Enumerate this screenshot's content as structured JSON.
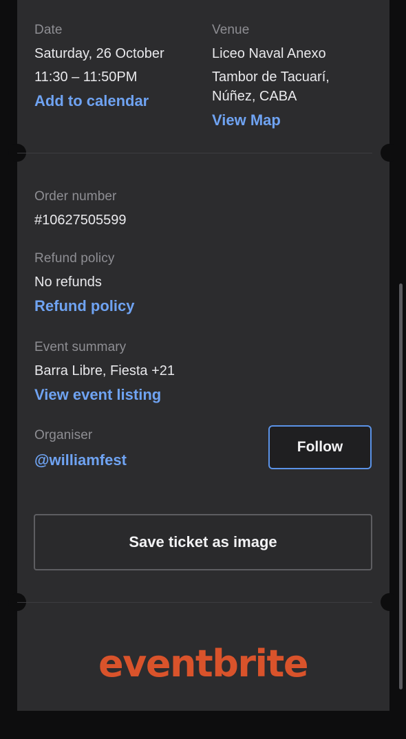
{
  "colors": {
    "background": "#0d0d0e",
    "card": "#2c2c2e",
    "label": "#8e8e93",
    "value": "#e9e9ec",
    "link": "#6fa3f2",
    "follow_border": "#5b93e8",
    "brand": "#d9532b"
  },
  "date": {
    "label": "Date",
    "line1": "Saturday, 26 October",
    "line2": "11:30 – 11:50PM",
    "add_to_calendar": "Add to calendar"
  },
  "venue": {
    "label": "Venue",
    "name": "Liceo Naval Anexo",
    "address_line1": "Tambor de Tacuarí,",
    "address_line2": "Núñez, CABA",
    "view_map": "View Map"
  },
  "order": {
    "label": "Order number",
    "value": "#10627505599"
  },
  "refund": {
    "label": "Refund policy",
    "value": "No refunds",
    "link": "Refund policy"
  },
  "event_summary": {
    "label": "Event summary",
    "value": "Barra Libre, Fiesta +21",
    "link": "View event listing"
  },
  "organiser": {
    "label": "Organiser",
    "handle": "@williamfest",
    "follow_label": "Follow"
  },
  "actions": {
    "save_ticket_label": "Save ticket as image"
  },
  "brand": {
    "logo_text": "eventbrite"
  }
}
